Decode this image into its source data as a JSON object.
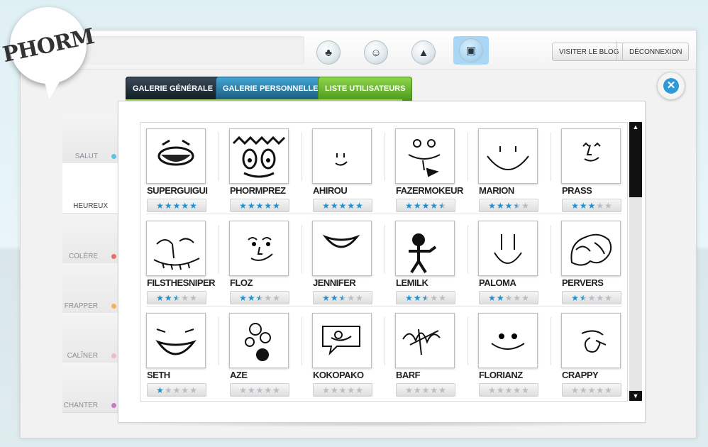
{
  "logo": {
    "text": "PHORM"
  },
  "nav": {
    "icons": [
      {
        "name": "tree-icon",
        "glyph": "♣",
        "active": false
      },
      {
        "name": "group-icon",
        "glyph": "☺",
        "active": false
      },
      {
        "name": "pencil-icon",
        "glyph": "▲",
        "active": false
      },
      {
        "name": "gallery-icon",
        "glyph": "▣",
        "active": true
      }
    ],
    "visit_blog": "VISITER LE BLOG",
    "logout": "DÉCONNEXION"
  },
  "tabs": {
    "general": "GALERIE GÉNÉRALE",
    "personal": "GALERIE PERSONNELLE",
    "users": "LISTE UTILISATEURS"
  },
  "moods": [
    {
      "label": "SALUT",
      "color": "#5ec1e6",
      "active": false
    },
    {
      "label": "HEUREUX",
      "color": "#8cc43a",
      "active": true
    },
    {
      "label": "COLÈRE",
      "color": "#ee6b6b",
      "active": false
    },
    {
      "label": "FRAPPER",
      "color": "#f2b35a",
      "active": false
    },
    {
      "label": "CALÎNER",
      "color": "#f2b8cf",
      "active": false
    },
    {
      "label": "CHANTER",
      "color": "#c879c0",
      "active": false
    }
  ],
  "gallery": [
    {
      "name": "SUPERGUIGUI",
      "rating": 5
    },
    {
      "name": "PHORMPREZ",
      "rating": 5
    },
    {
      "name": "AHIROU",
      "rating": 5
    },
    {
      "name": "FAZERMOKEUR",
      "rating": 4.5
    },
    {
      "name": "MARION",
      "rating": 3.5
    },
    {
      "name": "PRASS",
      "rating": 3
    },
    {
      "name": "FILSTHESNIPER",
      "rating": 2.5
    },
    {
      "name": "FLOZ",
      "rating": 2.5
    },
    {
      "name": "JENNIFER",
      "rating": 2.5
    },
    {
      "name": "LEMILK",
      "rating": 2.5
    },
    {
      "name": "PALOMA",
      "rating": 2
    },
    {
      "name": "PERVERS",
      "rating": 1.5
    },
    {
      "name": "SETH",
      "rating": 1
    },
    {
      "name": "AZE",
      "rating": 0
    },
    {
      "name": "KOKOPAKO",
      "rating": 0
    },
    {
      "name": "BARF",
      "rating": 0
    },
    {
      "name": "FLORIANZ",
      "rating": 0
    },
    {
      "name": "CRAPPY",
      "rating": 0
    }
  ],
  "scroll": {
    "up": "▲",
    "down": "▼"
  },
  "close": {
    "glyph": "✕"
  }
}
